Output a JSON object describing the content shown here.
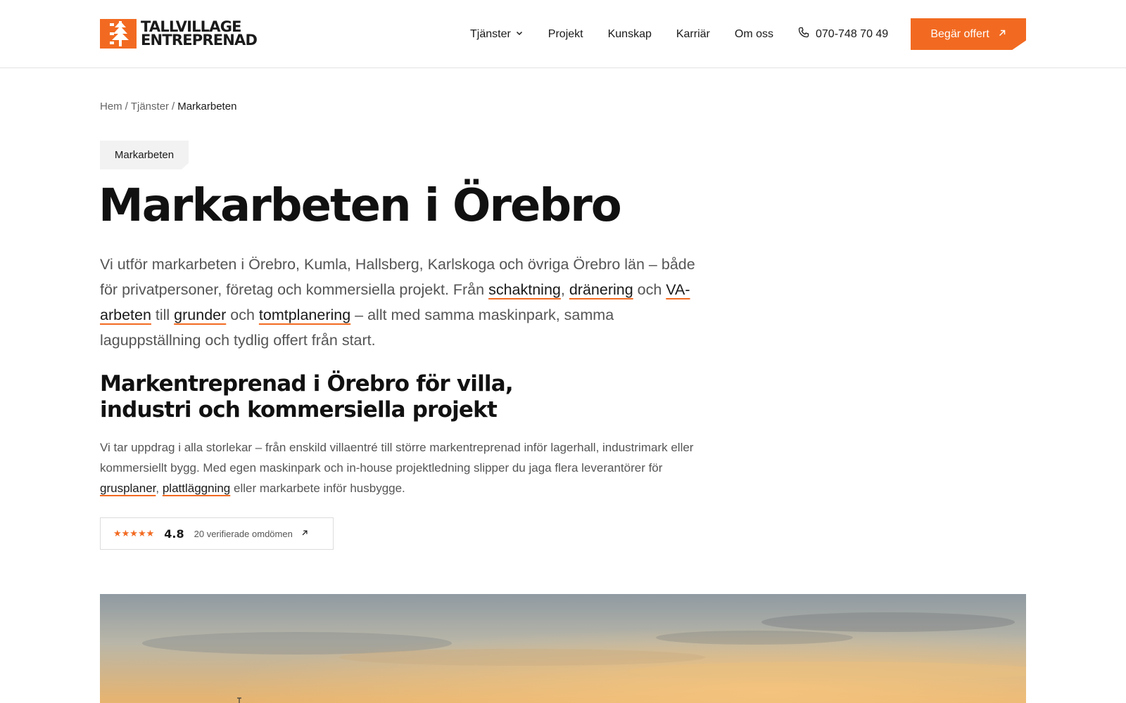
{
  "brand": {
    "line1": "TALLVILLAGE",
    "line2": "ENTREPRENAD",
    "accent_color": "#f26a21"
  },
  "nav": {
    "items": [
      {
        "label": "Tjänster",
        "has_dropdown": true
      },
      {
        "label": "Projekt"
      },
      {
        "label": "Kunskap"
      },
      {
        "label": "Karriär"
      },
      {
        "label": "Om oss"
      }
    ],
    "phone": "070-748 70 49",
    "cta": "Begär offert"
  },
  "breadcrumb": {
    "home": "Hem",
    "section": "Tjänster",
    "current": "Markarbeten",
    "separator": "/"
  },
  "tag": "Markarbeten",
  "hero": {
    "title": "Markarbeten i Örebro",
    "intro": {
      "t1": "Vi utför markarbeten i Örebro, Kumla, Hallsberg, Karlskoga och övriga Örebro län – både för privatpersoner, företag och kommersiella projekt. Från ",
      "l1": "schaktning",
      "t2": ", ",
      "l2": "dränering",
      "t3": " och ",
      "l3": "VA-arbeten",
      "t4": " till ",
      "l4": "grunder",
      "t5": " och ",
      "l5": "tomtplanering",
      "t6": " – allt med samma maskinpark, samma laguppställning och tydlig offert från start."
    }
  },
  "section": {
    "title_line1": "Markentreprenad i Örebro för villa,",
    "title_line2": "industri och kommersiella projekt",
    "body": {
      "t1": "Vi tar uppdrag i alla storlekar – från enskild villaentré till större markentreprenad inför lagerhall, industrimark eller kommersiellt bygg. Med egen maskinpark och in-house projektledning slipper du jaga flera leverantörer för ",
      "l1": "grusplaner",
      "t2": ", ",
      "l2": "plattläggning",
      "t3": " eller markarbete inför husbygge."
    }
  },
  "rating": {
    "stars": "★★★★★",
    "score": "4.8",
    "count_label": "20 verifierade omdömen",
    "stars_value": 5
  },
  "icons": {
    "logo": "tree-logo-icon",
    "dropdown": "chevron-down-icon",
    "phone": "phone-icon",
    "cta_arrow": "arrow-up-right-icon"
  }
}
